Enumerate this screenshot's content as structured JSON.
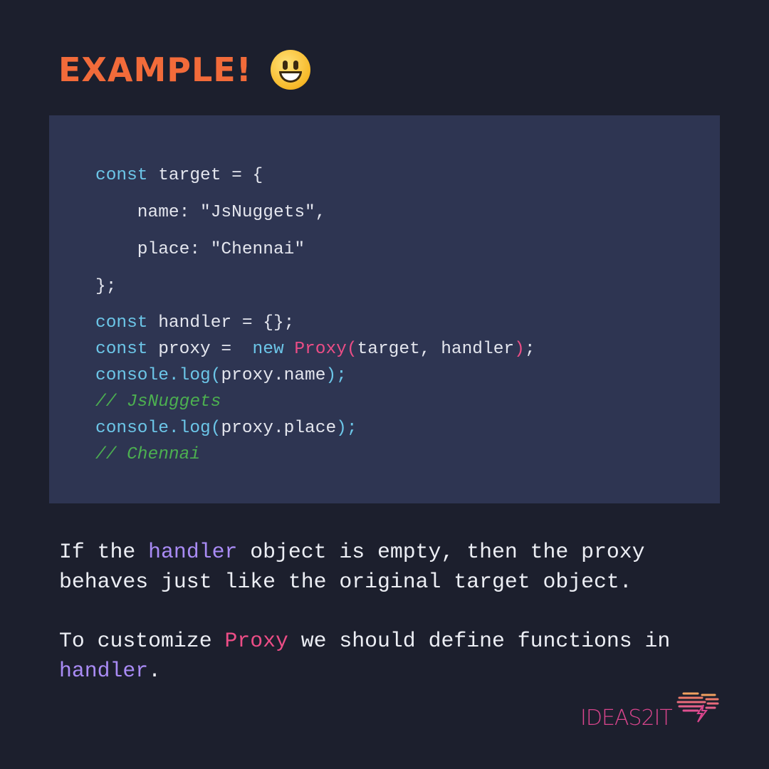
{
  "title": "EXAMPLE!",
  "title_emoji": "smiling-face-icon",
  "colors": {
    "background": "#1c1f2d",
    "code_box": "#2e3552",
    "title": "#f26b3a",
    "keyword": "#6cc6e8",
    "function": "#ec4d86",
    "comment": "#4caf50",
    "highlight": "#a98bf5"
  },
  "code_lines": [
    [
      [
        "const",
        "kw"
      ],
      [
        " target = {",
        "tx"
      ]
    ],
    [
      [
        "    name: \"JsNuggets\",",
        "tx"
      ]
    ],
    [
      [
        "    place: \"Chennai\"",
        "tx"
      ]
    ],
    [
      [
        "};",
        "tx"
      ]
    ],
    [
      [
        "const",
        "kw"
      ],
      [
        " handler = {};",
        "tx"
      ]
    ],
    [
      [
        "const",
        "kw"
      ],
      [
        " proxy =  ",
        "tx"
      ],
      [
        "new",
        "kw"
      ],
      [
        " ",
        "tx"
      ],
      [
        "Proxy(",
        "fn"
      ],
      [
        "target, handler",
        "tx"
      ],
      [
        ")",
        "fn"
      ],
      [
        ";",
        "tx"
      ]
    ],
    [
      [
        "console.log(",
        "kw"
      ],
      [
        "proxy.name",
        "tx"
      ],
      [
        ");",
        "kw"
      ]
    ],
    [
      [
        "// JsNuggets",
        "cm"
      ]
    ],
    [
      [
        "console.log(",
        "kw"
      ],
      [
        "proxy.place",
        "tx"
      ],
      [
        ");",
        "kw"
      ]
    ],
    [
      [
        "// Chennai",
        "cm"
      ]
    ]
  ],
  "paragraph1": {
    "p1": "If the ",
    "hl": "handler",
    "p2": " object is empty, then the proxy\nbehaves just like the original target object."
  },
  "paragraph2": {
    "p1": "To customize ",
    "hl1": "Proxy",
    "p2": " we should define functions in\n",
    "hl2": "handler",
    "p3": "."
  },
  "logo": {
    "text": "IDEAS2IT",
    "icon": "brain-lightning-icon"
  }
}
